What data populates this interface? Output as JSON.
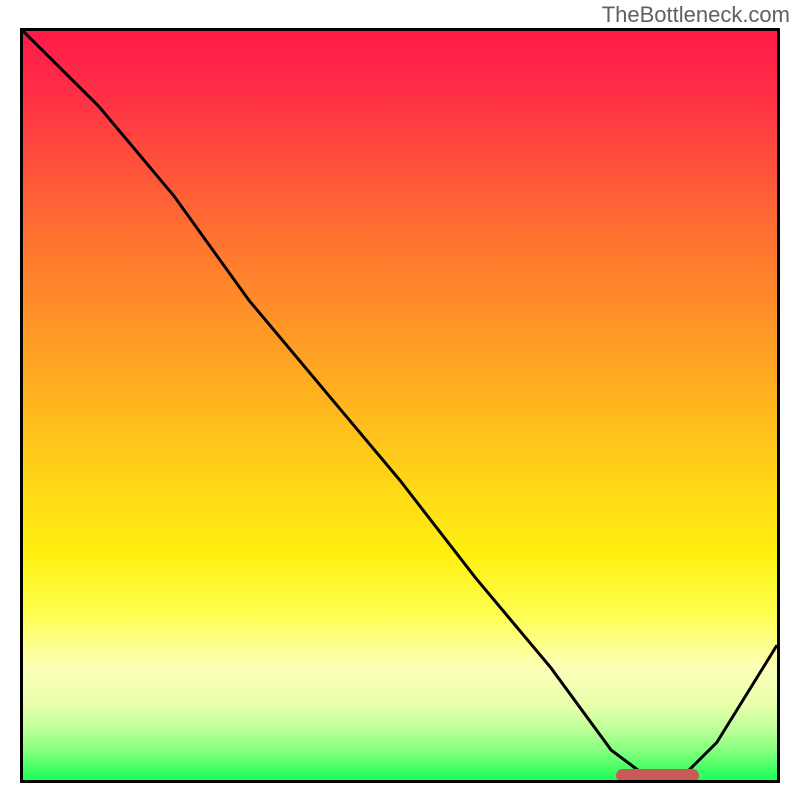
{
  "watermark": "TheBottleneck.com",
  "chart_data": {
    "type": "line",
    "title": "",
    "xlabel": "",
    "ylabel": "",
    "xlim": [
      0,
      100
    ],
    "ylim": [
      0,
      100
    ],
    "series": [
      {
        "name": "curve",
        "x": [
          0,
          10,
          20,
          25,
          30,
          40,
          50,
          60,
          70,
          78,
          82,
          88,
          92,
          100
        ],
        "y": [
          100,
          90,
          78,
          71,
          64,
          52,
          40,
          27,
          15,
          4,
          1,
          1,
          5,
          18
        ]
      }
    ],
    "marker": {
      "x_start": 78,
      "x_end": 89,
      "y": 1.5,
      "color": "#c85a5a"
    },
    "gradient": {
      "top": "#ff1a47",
      "middle": "#ffb61e",
      "bottom": "#1dff56"
    }
  }
}
